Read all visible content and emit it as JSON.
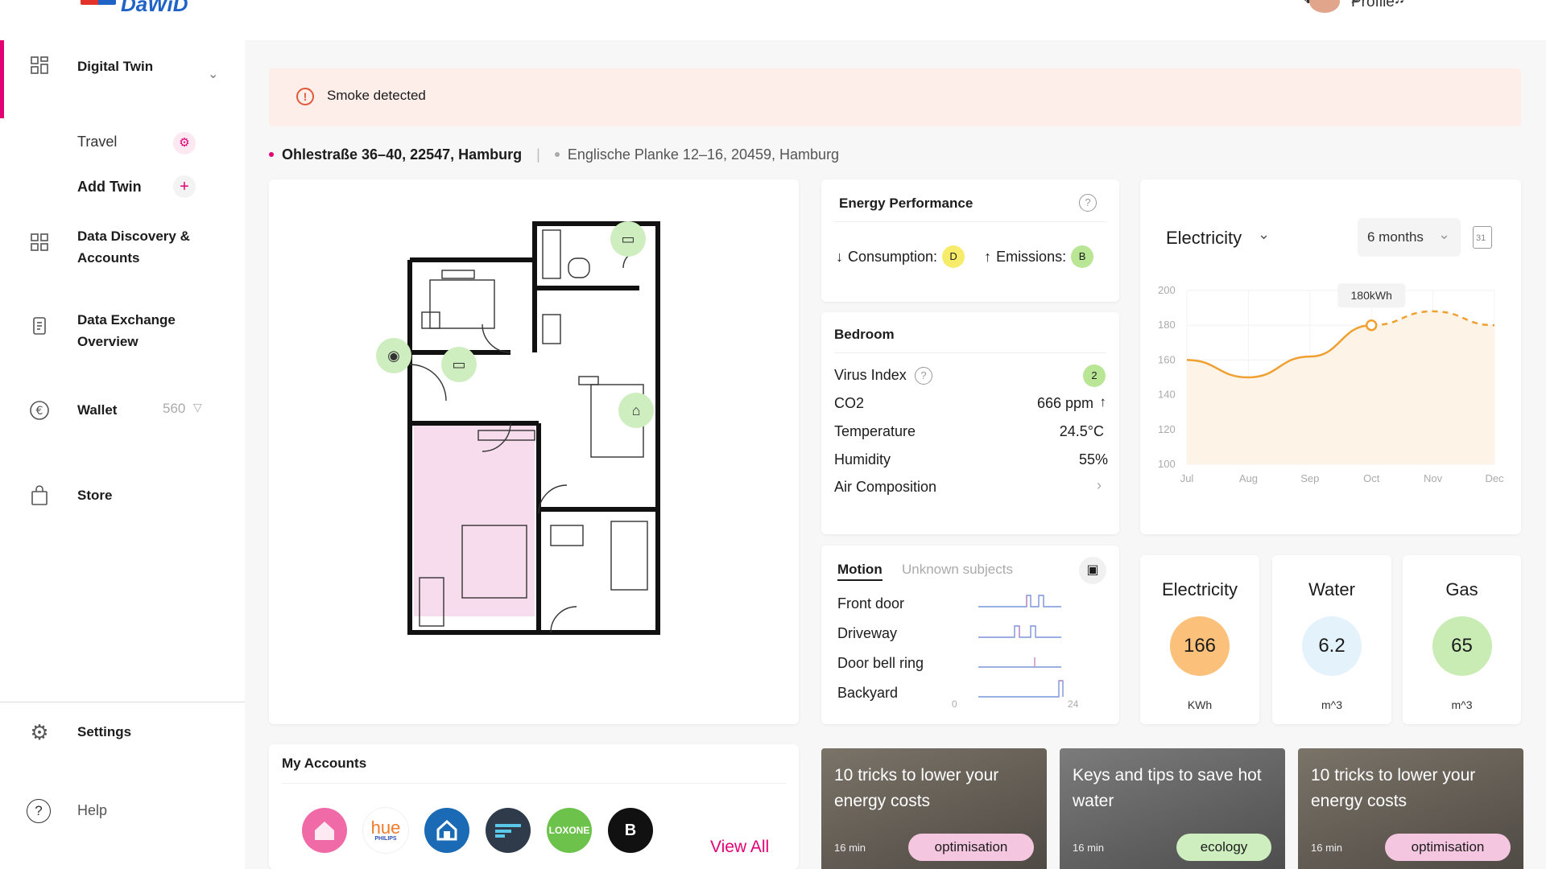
{
  "topbar": {
    "logo_text": "DaWiD",
    "username": "Profile"
  },
  "sidebar": {
    "items": [
      {
        "label": "Digital Twin"
      },
      {
        "label": "Data Discovery & Accounts"
      },
      {
        "label": "Data Exchange Overview"
      },
      {
        "label": "Wallet",
        "value": "560"
      },
      {
        "label": "Store"
      }
    ],
    "subitems": [
      {
        "label": "Travel"
      },
      {
        "label": "Add Twin"
      }
    ],
    "settings_label": "Settings",
    "help_label": "Help"
  },
  "alert": {
    "text": "Smoke detected"
  },
  "addresses": {
    "active": "Ohlestraße 36–40, 22547, Hamburg",
    "other": "Englische Planke 12–16, 20459, Hamburg"
  },
  "energy": {
    "title": "Energy Performance",
    "consumption_label": "Consumption:",
    "consumption_grade": "D",
    "emissions_label": "Emissions:",
    "emissions_grade": "B"
  },
  "room": {
    "title": "Bedroom",
    "rows": [
      {
        "label": "Virus Index",
        "value": "2"
      },
      {
        "label": "CO2",
        "value": "666 ppm"
      },
      {
        "label": "Temperature",
        "value": "24.5°C"
      },
      {
        "label": "Humidity",
        "value": "55%"
      },
      {
        "label": "Air Composition",
        "value": "›"
      }
    ]
  },
  "chart_card": {
    "selector": "Electricity",
    "range": "6 months",
    "calendar": "31"
  },
  "chart_data": {
    "type": "line",
    "x": [
      "Jul",
      "Aug",
      "Sep",
      "Oct",
      "Nov",
      "Dec"
    ],
    "series": [
      {
        "values": [
          160,
          150,
          162,
          180,
          188,
          180
        ]
      }
    ],
    "ylim": [
      100,
      200
    ],
    "yticks": [
      "200",
      "180",
      "160",
      "140",
      "120",
      "100"
    ],
    "annotation": "180kWh",
    "colors": {
      "line": "#f0a030",
      "fill": "#fdf3e6"
    }
  },
  "motion": {
    "tabs": [
      "Motion",
      "Unknown subjects"
    ],
    "rows": [
      "Front door",
      "Driveway",
      "Door bell ring",
      "Backyard"
    ],
    "axis_start": "0",
    "axis_end": "24"
  },
  "meters": [
    {
      "title": "Electricity",
      "value": "166",
      "unit": "KWh",
      "color": "#fbc07a"
    },
    {
      "title": "Water",
      "value": "6.2",
      "unit": "m^3",
      "color": "#e4f2fb"
    },
    {
      "title": "Gas",
      "value": "65",
      "unit": "m^3",
      "color": "#c9ecb5"
    }
  ],
  "accounts": {
    "title": "My Accounts",
    "view_all": "View All",
    "items": [
      "hue",
      "PHILIPS",
      "LOXONE",
      "B"
    ]
  },
  "articles": [
    {
      "title": "10 tricks to lower your energy costs",
      "time": "16 min",
      "tag": "optimisation"
    },
    {
      "title": "Keys and tips to save hot water",
      "time": "16 min",
      "tag": "ecology"
    },
    {
      "title": "10 tricks to lower your energy costs",
      "time": "16 min",
      "tag": "optimisation"
    }
  ]
}
